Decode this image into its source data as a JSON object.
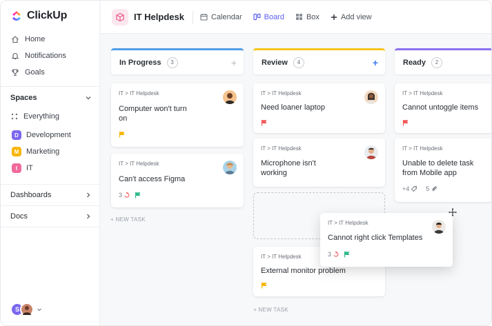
{
  "app": {
    "name": "ClickUp"
  },
  "sidebar": {
    "nav": [
      {
        "label": "Home",
        "icon": "home-icon"
      },
      {
        "label": "Notifications",
        "icon": "bell-icon"
      },
      {
        "label": "Goals",
        "icon": "trophy-icon"
      }
    ],
    "spaces_label": "Spaces",
    "everything_label": "Everything",
    "spaces": [
      {
        "badge": "D",
        "label": "Development",
        "color": "#7b68ee"
      },
      {
        "badge": "M",
        "label": "Marketing",
        "color": "#f7b500"
      },
      {
        "badge": "I",
        "label": "IT",
        "color": "#f06a9b"
      }
    ],
    "dashboards_label": "Dashboards",
    "docs_label": "Docs",
    "user_initial": "S"
  },
  "header": {
    "title": "IT Helpdesk",
    "tabs": [
      {
        "label": "Calendar",
        "icon": "calendar-icon"
      },
      {
        "label": "Board",
        "icon": "board-icon",
        "active": true
      },
      {
        "label": "Box",
        "icon": "box-icon"
      },
      {
        "label": "Add view",
        "icon": "plus-icon"
      }
    ]
  },
  "columns": [
    {
      "title": "In Progress",
      "count": "3",
      "color": "#4f9de8"
    },
    {
      "title": "Review",
      "count": "4",
      "color": "#f5c51c"
    },
    {
      "title": "Ready",
      "count": "2",
      "color": "#8b6ff0"
    }
  ],
  "cards": {
    "c1": {
      "crumb": "IT > IT Helpdesk",
      "title": "Computer won't turn on"
    },
    "c2": {
      "crumb": "IT > IT Helpdesk",
      "title": "Can't access Figma",
      "subtasks": "3"
    },
    "c3": {
      "crumb": "IT > IT Helpdesk",
      "title": "Need loaner laptop"
    },
    "c4": {
      "crumb": "IT > IT Helpdesk",
      "title": "Microphone isn't working"
    },
    "c5": {
      "crumb": "IT > IT Helpdesk",
      "title": "External monitor problem"
    },
    "c6": {
      "crumb": "IT > IT Helpdesk",
      "title": "Cannot untoggle items"
    },
    "c7": {
      "crumb": "IT > IT Helpdesk",
      "title": "Unable to delete task from Mobile app",
      "tags": "+4",
      "attachments": "5"
    },
    "drag": {
      "crumb": "IT > IT Helpdesk",
      "title": "Cannot right click Templates",
      "subtasks": "3"
    }
  },
  "new_task_label": "+ NEW TASK",
  "colors": {
    "accent": "#5b5ff0",
    "flag_yellow": "#f7b500",
    "flag_red": "#f25757",
    "flag_green": "#2fb88c"
  }
}
